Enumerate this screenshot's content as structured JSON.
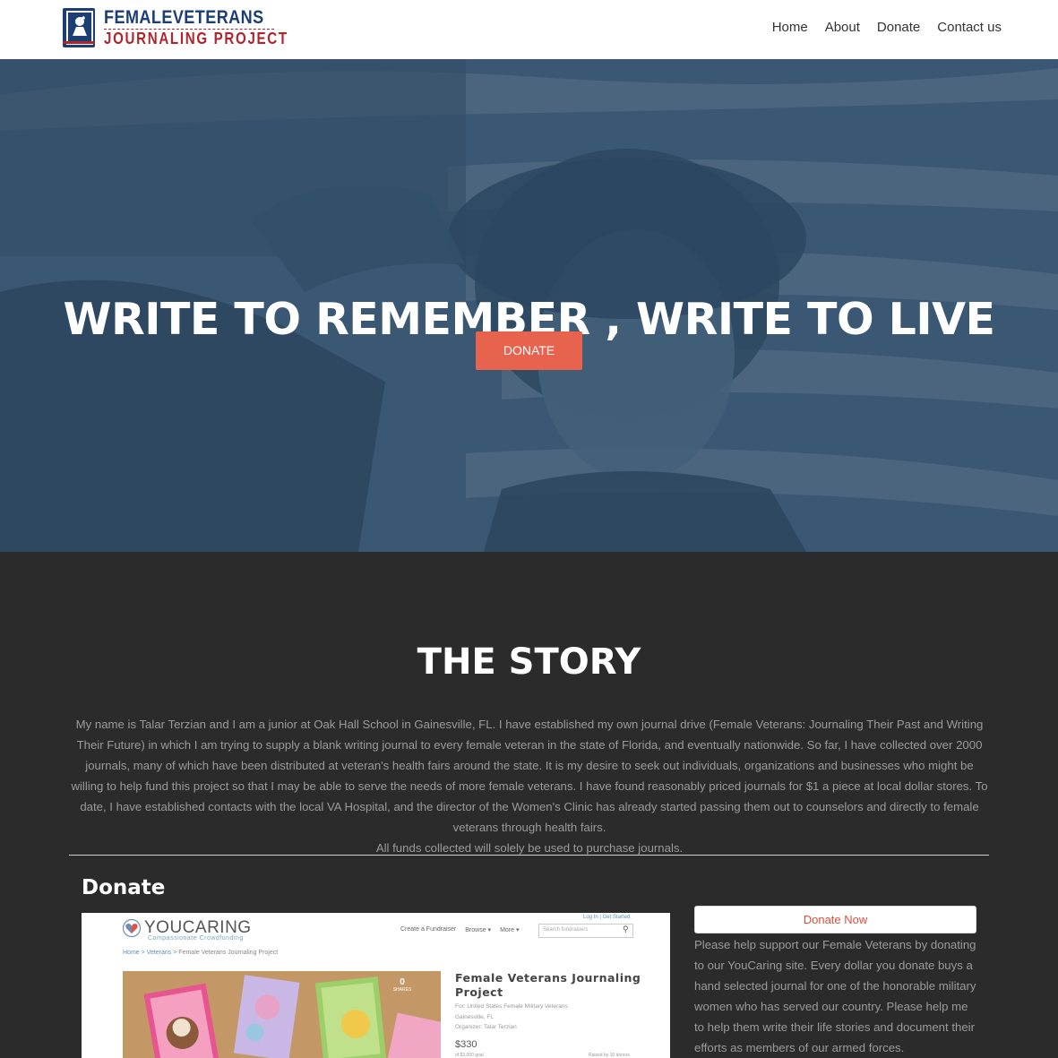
{
  "header": {
    "logo_line1": "FEMALEVETERANS",
    "logo_line2": "JOURNALING PROJECT",
    "nav": [
      "Home",
      "About",
      "Donate",
      "Contact us"
    ]
  },
  "hero": {
    "title": "WRITE TO REMEMBER , WRITE TO LIVE",
    "button": "DONATE"
  },
  "story": {
    "title": "THE STORY",
    "paragraph": "My name is Talar Terzian and I am a junior at Oak Hall School in Gainesville, FL. I have established my own journal drive (Female Veterans: Journaling Their Past and Writing Their Future) in which I am trying to supply a blank writing journal to every female veteran in the state of Florida, and eventually nationwide. So far, I have collected over 2000 journals, many of which have been distributed at veteran's health fairs around the state. It is my desire to seek out individuals, organizations and businesses who might be willing to help fund this project so that I may be able to serve the needs of more female veterans. I have found reasonably priced journals for $1 a piece at local dollar stores. To date, I have established contacts with the local VA Hospital, and the director of the Women's Clinic has already started passing them out to counselors and directly to female veterans through health fairs.",
    "note": "All funds collected will solely be used to purchase journals."
  },
  "donate": {
    "heading": "Donate",
    "button": "Donate Now",
    "text": "Please help support our Female Veterans by donating to our YouCaring site. Every dollar you donate buys a hand selected journal for one of the honorable military women who has served our country. Please help me to help them write their life stories and document their efforts as members of our armed forces."
  },
  "youcaring": {
    "brand": "YOUCARING",
    "tagline": "Compassionate Crowdfunding",
    "top_links": "Log In  |  Get Started",
    "nav": [
      "Create a Fundraiser",
      "Browse ▾",
      "More ▾"
    ],
    "search_placeholder": "Search fundraisers",
    "breadcrumb_home": "Home",
    "breadcrumb_cat": "Veterans",
    "breadcrumb_current": "Female Veterans Journaling Project",
    "shares_count": "0",
    "shares_label": "SHARES",
    "title": "Female Veterans Journaling Project",
    "for": "For: United States Female Military Veterans",
    "location": "Gainesville, FL",
    "organizer": "Organizer: Talar Terzian",
    "amount": "$330",
    "goal": "of $3,000 goal",
    "raised_by": "Raised by 10 donors"
  },
  "colors": {
    "accent": "#e8634e",
    "hero_overlay": "#35526e",
    "dark_bg": "#2b2b2b",
    "logo_blue": "#1c3f73",
    "logo_red": "#b2242b"
  }
}
